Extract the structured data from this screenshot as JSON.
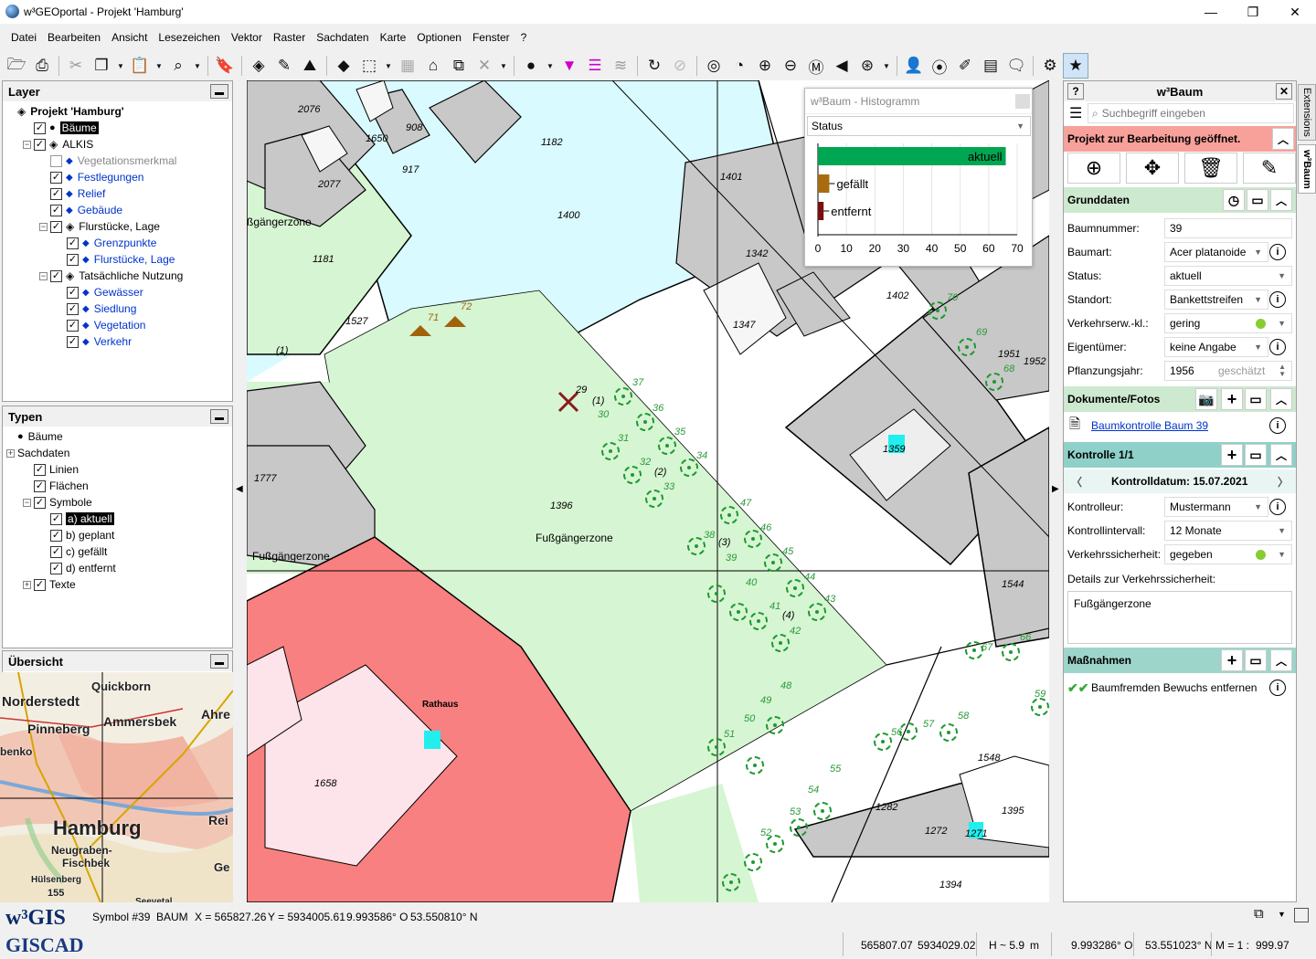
{
  "window": {
    "title": "w³GEOportal - Projekt 'Hamburg'",
    "minimize": "—",
    "maximize": "❐",
    "close": "✕"
  },
  "menu": [
    "Datei",
    "Bearbeiten",
    "Ansicht",
    "Lesezeichen",
    "Vektor",
    "Raster",
    "Sachdaten",
    "Karte",
    "Optionen",
    "Fenster",
    "?"
  ],
  "layer_panel": {
    "title": "Layer",
    "items": [
      {
        "label": "Projekt 'Hamburg'",
        "level": 0,
        "checkbox": false,
        "icon": "layers-icon",
        "bold": true,
        "exp": ""
      },
      {
        "label": "Bäume",
        "level": 1,
        "checkbox": true,
        "checked": true,
        "icon": "tree-icon",
        "selected": true,
        "exp": ""
      },
      {
        "label": "ALKIS",
        "level": 1,
        "checkbox": true,
        "checked": true,
        "icon": "layers-icon",
        "exp": "−"
      },
      {
        "label": "Vegetationsmerkmal",
        "level": 2,
        "checkbox": true,
        "checked": false,
        "icon": "diamond-icon",
        "grey": true,
        "exp": ""
      },
      {
        "label": "Festlegungen",
        "level": 2,
        "checkbox": true,
        "checked": true,
        "icon": "diamond-icon",
        "blue": true,
        "exp": ""
      },
      {
        "label": "Relief",
        "level": 2,
        "checkbox": true,
        "checked": true,
        "icon": "diamond-icon",
        "blue": true,
        "exp": ""
      },
      {
        "label": "Gebäude",
        "level": 2,
        "checkbox": true,
        "checked": true,
        "icon": "diamond-icon",
        "blue": true,
        "exp": ""
      },
      {
        "label": "Flurstücke, Lage",
        "level": 2,
        "checkbox": true,
        "checked": true,
        "icon": "layers-icon",
        "exp": "−"
      },
      {
        "label": "Grenzpunkte",
        "level": 3,
        "checkbox": true,
        "checked": true,
        "icon": "diamond-icon",
        "blue": true,
        "exp": ""
      },
      {
        "label": "Flurstücke, Lage",
        "level": 3,
        "checkbox": true,
        "checked": true,
        "icon": "diamond-icon",
        "blue": true,
        "exp": ""
      },
      {
        "label": "Tatsächliche Nutzung",
        "level": 2,
        "checkbox": true,
        "checked": true,
        "icon": "layers-icon",
        "exp": "−"
      },
      {
        "label": "Gewässer",
        "level": 3,
        "checkbox": true,
        "checked": true,
        "icon": "diamond-icon",
        "blue": true,
        "exp": ""
      },
      {
        "label": "Siedlung",
        "level": 3,
        "checkbox": true,
        "checked": true,
        "icon": "diamond-icon",
        "blue": true,
        "exp": ""
      },
      {
        "label": "Vegetation",
        "level": 3,
        "checkbox": true,
        "checked": true,
        "icon": "diamond-icon",
        "blue": true,
        "exp": ""
      },
      {
        "label": "Verkehr",
        "level": 3,
        "checkbox": true,
        "checked": true,
        "icon": "diamond-icon",
        "blue": true,
        "exp": ""
      }
    ]
  },
  "types_panel": {
    "title": "Typen",
    "items": [
      {
        "label": "Bäume",
        "level": 0,
        "checkbox": false,
        "icon": "tree-icon",
        "exp": ""
      },
      {
        "label": "Sachdaten",
        "level": 0,
        "checkbox": false,
        "exp": "+"
      },
      {
        "label": "Linien",
        "level": 1,
        "checkbox": true,
        "checked": true,
        "exp": ""
      },
      {
        "label": "Flächen",
        "level": 1,
        "checkbox": true,
        "checked": true,
        "exp": ""
      },
      {
        "label": "Symbole",
        "level": 1,
        "checkbox": true,
        "checked": true,
        "exp": "−"
      },
      {
        "label": "a) aktuell",
        "level": 2,
        "checkbox": true,
        "checked": true,
        "selected": true,
        "exp": ""
      },
      {
        "label": "b) geplant",
        "level": 2,
        "checkbox": true,
        "checked": true,
        "exp": ""
      },
      {
        "label": "c) gefällt",
        "level": 2,
        "checkbox": true,
        "checked": true,
        "exp": ""
      },
      {
        "label": "d) entfernt",
        "level": 2,
        "checkbox": true,
        "checked": true,
        "exp": ""
      },
      {
        "label": "Texte",
        "level": 1,
        "checkbox": true,
        "checked": true,
        "exp": "+"
      }
    ]
  },
  "overview_panel": {
    "title": "Übersicht",
    "places": [
      "Quickborn",
      "Norderstedt",
      "Pinneberg",
      "Ammersbek",
      "Ahre",
      "benkо",
      "Hamburg",
      "Rei",
      "Neugraben-",
      "Fischbek",
      "Ge",
      "Hülsenberg",
      "155",
      "Seevetal"
    ]
  },
  "map": {
    "labels": [
      "2076",
      "908",
      "1650",
      "1182",
      "917",
      "2077",
      "1401",
      "1400",
      "ßgängerzone",
      "1181",
      "1342",
      "1527",
      "71",
      "72",
      "1347",
      "1402",
      "70",
      "69",
      "1951",
      "1952",
      "68",
      "1359",
      "37",
      "29",
      "(1)",
      "30",
      "36",
      "35",
      "31",
      "34",
      "32",
      "(2)",
      "33",
      "1777",
      "1396",
      "Fußgängerzone",
      "47",
      "38",
      "(3)",
      "46",
      "39",
      "45",
      "Fußgängerzone",
      "40",
      "44",
      "1544",
      "41",
      "(4)",
      "43",
      "42",
      "66",
      "67",
      "Rathaus",
      "48",
      "49",
      "59",
      "50",
      "58",
      "51",
      "56",
      "57",
      "1548",
      "55",
      "1658",
      "54",
      "1282",
      "1395",
      "53",
      "1272",
      "1271",
      "52",
      "1394",
      "(1)"
    ]
  },
  "histogram": {
    "title": "w³Baum - Histogramm",
    "field": "Status",
    "close": ""
  },
  "chart_data": {
    "type": "bar",
    "orientation": "horizontal",
    "categories": [
      "aktuell",
      "gefällt",
      "entfernt"
    ],
    "values": [
      66,
      4,
      2
    ],
    "colors": [
      "#00a651",
      "#a86c10",
      "#7a0f0f"
    ],
    "xlim": [
      0,
      70
    ],
    "xticks": [
      0,
      10,
      20,
      30,
      40,
      50,
      60,
      70
    ]
  },
  "baum_panel": {
    "title": "w³Baum",
    "search_placeholder": "Suchbegriff eingeben",
    "message": "Projekt zur Bearbeitung geöffnet.",
    "grunddaten": {
      "title": "Grunddaten",
      "fields": [
        {
          "label": "Baumnummer:",
          "value": "39",
          "type": "text"
        },
        {
          "label": "Baumart:",
          "value": "Acer platanoide",
          "type": "select",
          "info": true
        },
        {
          "label": "Status:",
          "value": "aktuell",
          "type": "select"
        },
        {
          "label": "Standort:",
          "value": "Bankettstreifen",
          "type": "select",
          "info": true
        },
        {
          "label": "Verkehrserw.-kl.:",
          "value": "gering",
          "type": "select",
          "dot": true
        },
        {
          "label": "Eigentümer:",
          "value": "keine Angabe",
          "type": "select",
          "info": true
        },
        {
          "label": "Pflanzungsjahr:",
          "value": "1956",
          "extra": "geschätzt",
          "type": "spin"
        }
      ]
    },
    "dokumente": {
      "title": "Dokumente/Fotos",
      "link": "Baumkontrolle Baum 39"
    },
    "kontrolle": {
      "title": "Kontrolle 1/1",
      "date": "Kontrolldatum: 15.07.2021",
      "fields": [
        {
          "label": "Kontrolleur:",
          "value": "Mustermann",
          "type": "select",
          "info": true
        },
        {
          "label": "Kontrollintervall:",
          "value": "12 Monate",
          "type": "select"
        },
        {
          "label": "Verkehrssicherheit:",
          "value": "gegeben",
          "type": "select",
          "dot": true
        }
      ],
      "details_label": "Details zur Verkehrssicherheit:",
      "details_value": "Fußgängerzone"
    },
    "massnahmen": {
      "title": "Maßnahmen",
      "item": "Baumfremden Bewuchs entfernen"
    },
    "colors": {
      "message_bg": "#f7a19a",
      "section_bg": "#cde9cf",
      "kontrolle_bg": "#8fd1c8",
      "massnahmen_bg": "#9ed5cb"
    }
  },
  "vtabs": [
    "Extensions",
    "w³Baum"
  ],
  "statusbar": {
    "logo1": "w³GIS",
    "logo2": "GISCAD",
    "symbol": "Symbol #39",
    "layer": "BAUM",
    "x": "X = 565827.26",
    "y": "Y = 5934005.61",
    "lon": "9.993586° O",
    "lat": "53.550810° N",
    "row2": [
      "565807.07",
      "5934029.02",
      "H ~ 5.9",
      "m",
      "9.993286° O",
      "53.551023° N",
      "M = 1 :",
      "999.97"
    ]
  }
}
